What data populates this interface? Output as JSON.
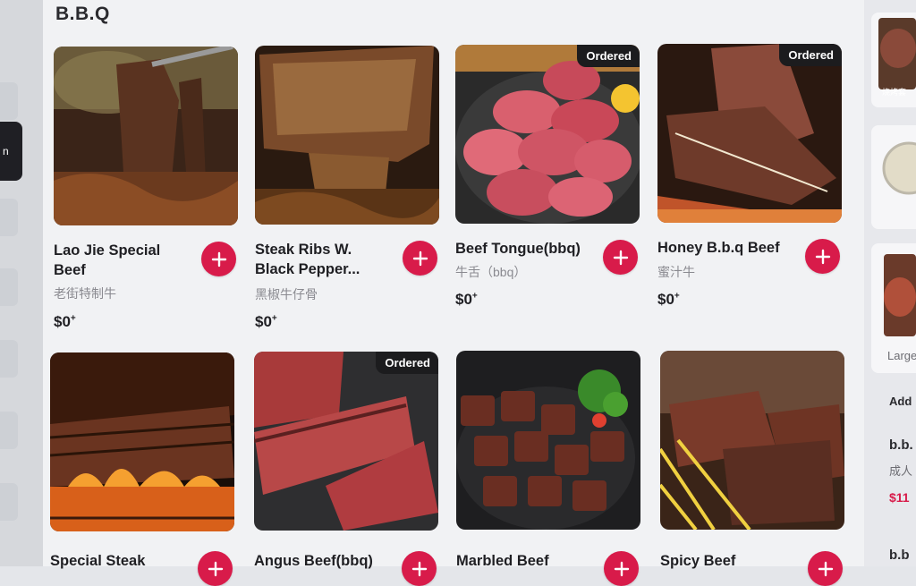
{
  "section": {
    "title": "B.B.Q"
  },
  "side_tab": {
    "label": "n"
  },
  "items": [
    {
      "name": "Lao Jie Special Beef",
      "subtitle": "老街特制牛",
      "price": "$0",
      "price_suffix": "+",
      "ordered": false
    },
    {
      "name": "Steak Ribs W. Black Pepper...",
      "subtitle": "黑椒牛仔骨",
      "price": "$0",
      "price_suffix": "+",
      "ordered": false
    },
    {
      "name": "Beef Tongue(bbq)",
      "subtitle": "牛舌（bbq）",
      "price": "$0",
      "price_suffix": "+",
      "ordered": true
    },
    {
      "name": "Honey B.b.q Beef",
      "subtitle": "蜜汁牛",
      "price": "$0",
      "price_suffix": "+",
      "ordered": true
    },
    {
      "name": "Special Steak",
      "ordered": false
    },
    {
      "name": "Angus Beef(bbq)",
      "ordered": true
    },
    {
      "name": "Marbled Beef",
      "ordered": false
    },
    {
      "name": "Spicy Beef",
      "ordered": false
    }
  ],
  "badge_label": "Ordered",
  "right_panel": {
    "tiny_label": "烧烤套",
    "size_label": "Large",
    "add_label": "Add",
    "item_name": "b.b.",
    "item_sub": "成人",
    "item_price": "$11",
    "item_name_2": "b.b"
  },
  "colors": {
    "accent": "#d81b4a",
    "badge": "#1c1c1e"
  },
  "icons": {
    "add": "plus-icon"
  }
}
